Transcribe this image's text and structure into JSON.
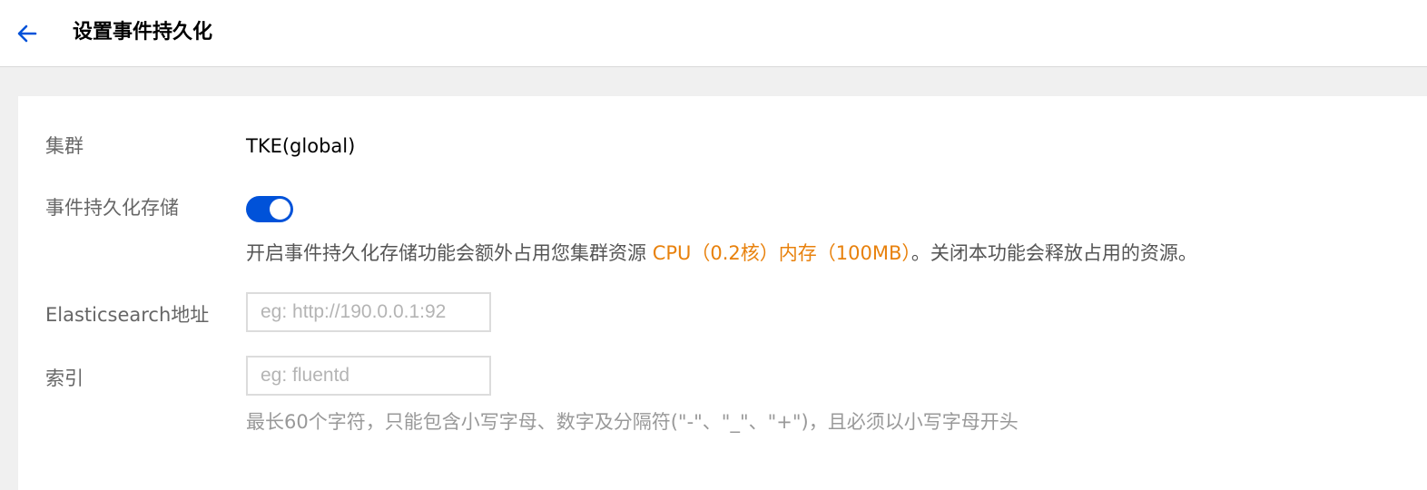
{
  "header": {
    "title": "设置事件持久化"
  },
  "form": {
    "cluster": {
      "label": "集群",
      "value": "TKE(global)"
    },
    "persistence": {
      "label": "事件持久化存储",
      "enabled": true,
      "hint_prefix": "开启事件持久化存储功能会额外占用您集群资源 ",
      "hint_highlight": "CPU（0.2核）内存（100MB）",
      "hint_suffix": "。关闭本功能会释放占用的资源。"
    },
    "es_address": {
      "label": "Elasticsearch地址",
      "value": "",
      "placeholder": "eg: http://190.0.0.1:92"
    },
    "index": {
      "label": "索引",
      "value": "",
      "placeholder": "eg: fluentd",
      "hint": "最长60个字符，只能包含小写字母、数字及分隔符(\"-\"、\"_\"、\"+\")，且必须以小写字母开头"
    }
  },
  "colors": {
    "primary": "#0052d9",
    "highlight": "#e8810c"
  }
}
